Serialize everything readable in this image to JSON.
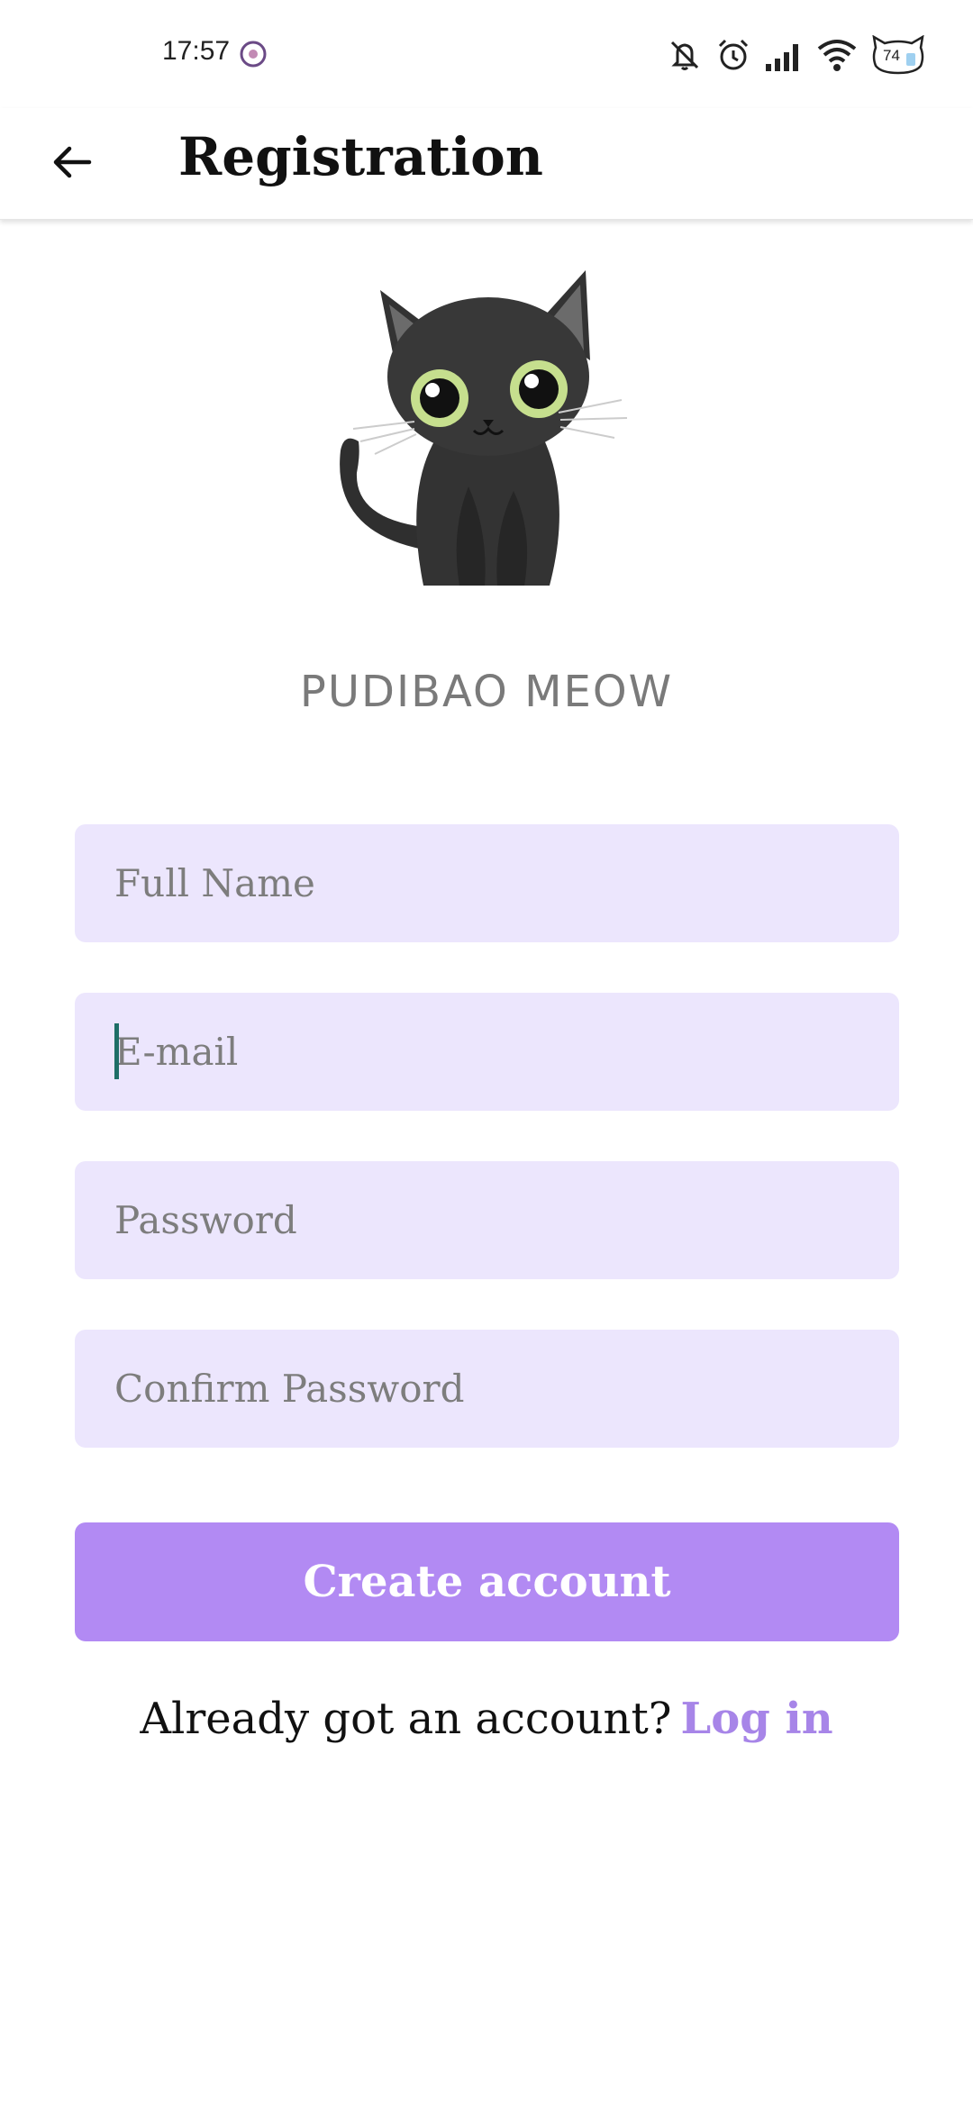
{
  "status_bar": {
    "time": "17:57",
    "battery_level": "74",
    "icons": [
      "app-notification-icon",
      "mute-icon",
      "alarm-icon",
      "signal-icon",
      "wifi-icon",
      "battery-icon"
    ]
  },
  "app_bar": {
    "title": "Registration",
    "back_icon": "arrow-left-icon"
  },
  "brand": {
    "name": "PUDIBAO MEOW",
    "logo": "black-cat-illustration"
  },
  "form": {
    "full_name": {
      "value": "",
      "placeholder": "Full Name"
    },
    "email": {
      "value": "",
      "placeholder": "E-mail",
      "focused": true
    },
    "password": {
      "value": "",
      "placeholder": "Password"
    },
    "confirm_password": {
      "value": "",
      "placeholder": "Confirm Password"
    },
    "submit_label": "Create account"
  },
  "login_prompt": {
    "text": "Already got an account?",
    "link_label": "Log in"
  },
  "colors": {
    "field_background": "#ece6fd",
    "button": "#b28af3",
    "link": "#a785e8",
    "caret": "#1e6e66"
  }
}
